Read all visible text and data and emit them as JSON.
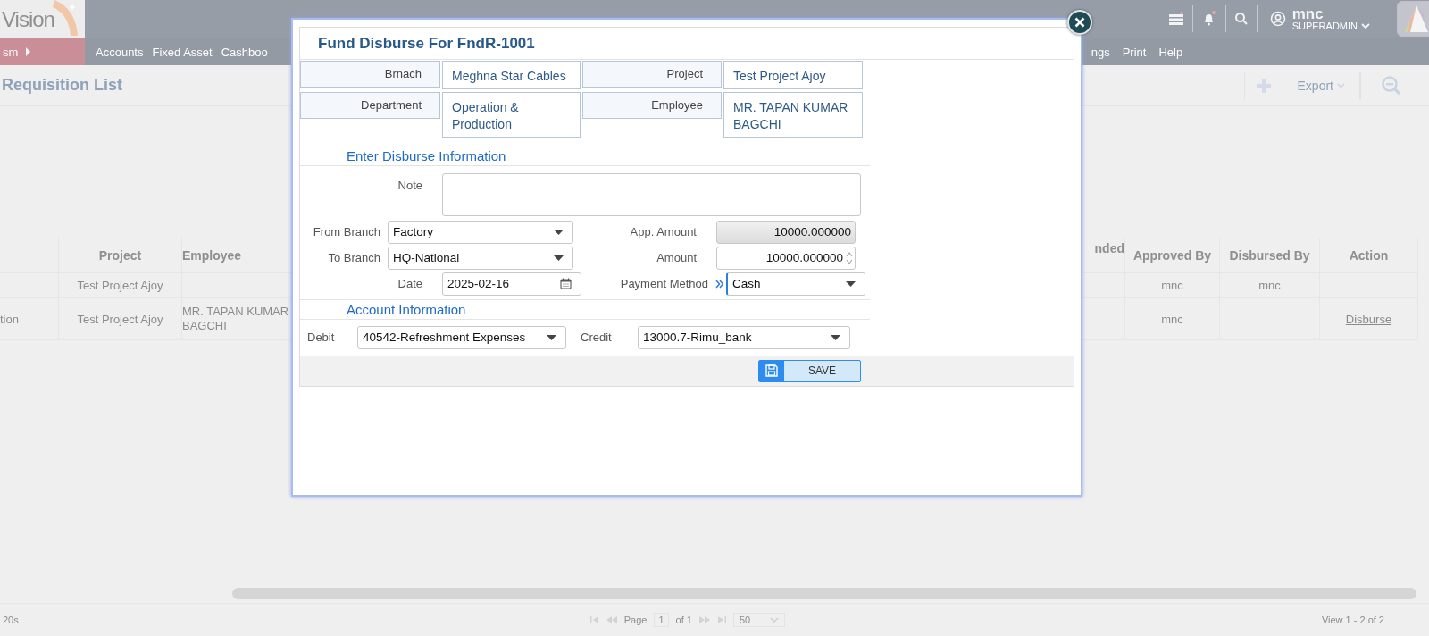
{
  "app": {
    "logo_text": "Vision",
    "module": "sm",
    "menu_left": [
      "Accounts",
      "Fixed Asset",
      "Cashboo"
    ],
    "menu_right": [
      "ngs",
      "Print",
      "Help"
    ],
    "user": {
      "name": "mnc",
      "role": "SUPERADMIN"
    }
  },
  "page": {
    "title": "Requisition List",
    "export_label": "Export"
  },
  "table": {
    "left_columns": {
      "project": "Project",
      "employee": "Employee"
    },
    "right_columns": {
      "column_4": "nded",
      "approved_by": "Approved By",
      "disbursed_by": "Disbursed By",
      "action": "Action"
    },
    "rows": [
      {
        "project": "Test Project Ajoy",
        "approved_by": "mnc",
        "disbursed_by": "mnc"
      },
      {
        "column_1": "tion",
        "project": "Test Project Ajoy",
        "employee": "MR. TAPAN KUMAR BAGCHI",
        "approved_by": "mnc",
        "action": "Disburse"
      }
    ]
  },
  "footer": {
    "left_text": "20s",
    "page_label": "Page",
    "page": "1",
    "of_label": "of 1",
    "page_size": "50",
    "view_text": "View 1 - 2 of 2"
  },
  "dialog": {
    "title": "Fund Disburse For FndR-1001",
    "info": [
      {
        "label": "Brnach",
        "value": "Meghna Star Cables"
      },
      {
        "label": "Project",
        "value": "Test Project Ajoy"
      },
      {
        "label": "Department",
        "value": "Operation & Production"
      },
      {
        "label": "Employee",
        "value": "MR. TAPAN KUMAR BAGCHI"
      }
    ],
    "disburse_section": "Enter Disburse Information",
    "note_label": "Note",
    "from_branch": {
      "label": "From Branch",
      "value": "Factory"
    },
    "to_branch": {
      "label": "To Branch",
      "value": "HQ-National"
    },
    "date": {
      "label": "Date",
      "value": "2025-02-16"
    },
    "app_amount": {
      "label": "App. Amount",
      "value": "10000.000000",
      "disabled": true
    },
    "amount": {
      "label": "Amount",
      "value": "10000.000000"
    },
    "payment_method": {
      "label": "Payment Method",
      "value": "Cash",
      "focused": true
    },
    "account_section": "Account Information",
    "debit": {
      "label": "Debit",
      "value": "40542-Refreshment Expenses"
    },
    "credit": {
      "label": "Credit",
      "value": "13000.7-Rimu_bank"
    },
    "save_label": "SAVE"
  }
}
